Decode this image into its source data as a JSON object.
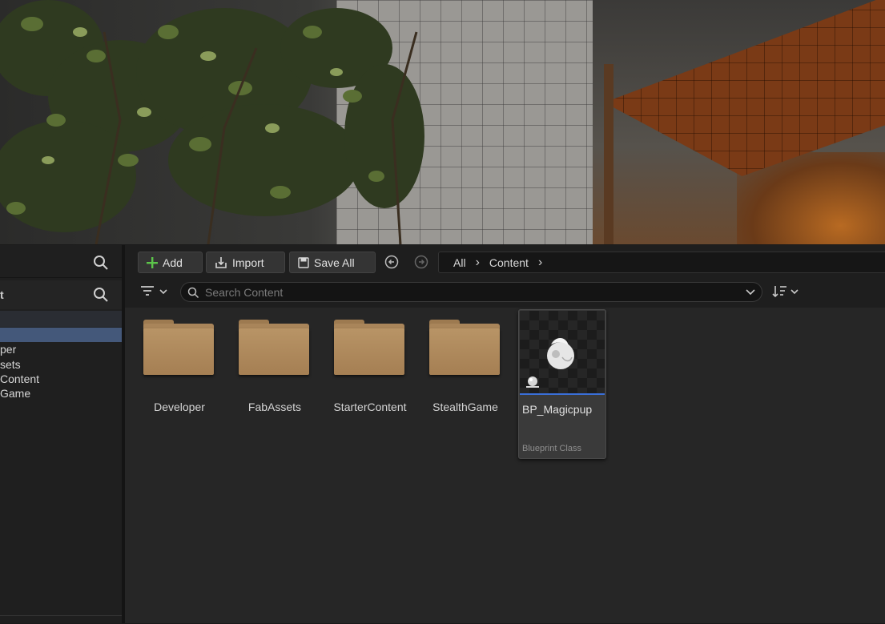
{
  "toolbar": {
    "add_label": "Add",
    "import_label": "Import",
    "save_all_label": "Save All"
  },
  "breadcrumb": {
    "items": [
      "All",
      "Content"
    ]
  },
  "search": {
    "placeholder": "Search Content"
  },
  "left_panel": {
    "title": "t",
    "tree_items": [
      "per",
      "sets",
      "Content",
      "Game"
    ]
  },
  "folders": [
    {
      "label": "Developer"
    },
    {
      "label": "FabAssets"
    },
    {
      "label": "StarterContent"
    },
    {
      "label": "StealthGame"
    }
  ],
  "asset": {
    "name": "BP_Magicpup",
    "type": "Blueprint Class"
  },
  "colors": {
    "folder": "#a9855a",
    "selection": "#44587a",
    "asset_underline": "#3a6fd8",
    "add_plus": "#5cc44a"
  }
}
